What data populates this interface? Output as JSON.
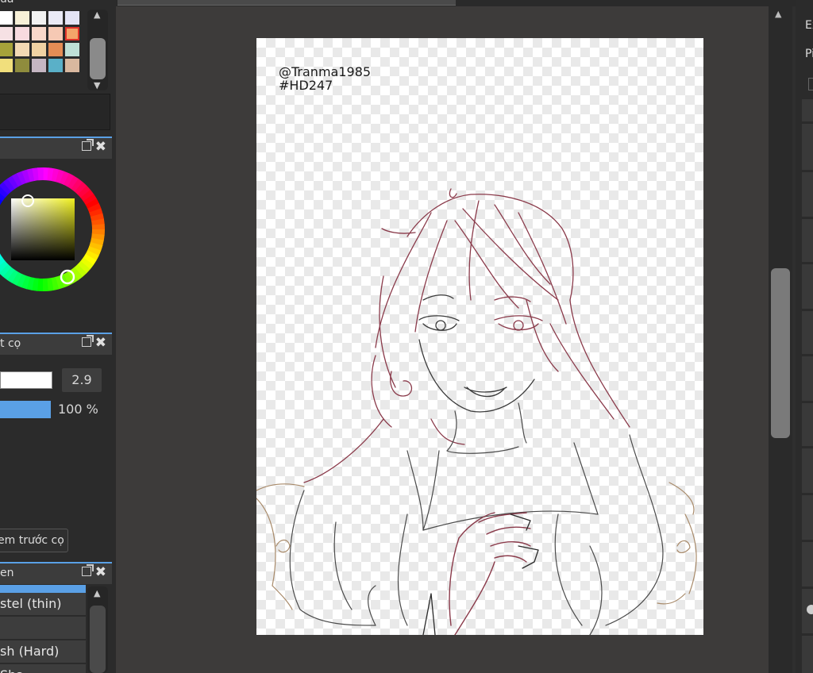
{
  "palette": {
    "title_fragment": "ủa",
    "colors": [
      [
        "#ffffff",
        "#f7f0d7",
        "#f2f2f2",
        "#eaeaf6",
        "#e4e4f5"
      ],
      [
        "#f6e1e4",
        "#f7dadf",
        "#f8d8ca",
        "#f6c9b4",
        "#f4a46a"
      ],
      [
        "#a6a23a",
        "#f3d9b4",
        "#f0d2a3",
        "#e58d55",
        "#bfe0d6"
      ],
      [
        "#f1df7c",
        "#8f8c3d",
        "#c5b6c2",
        "#5ab0c8",
        "#d9b89f"
      ]
    ],
    "selected_index": [
      1,
      4
    ]
  },
  "color_wheel_panel": {
    "hue_color": "#f0f020"
  },
  "brush_panel": {
    "title_fragment": "t cọ",
    "size_value": "2.9",
    "opacity_value": "100 %",
    "preview_button": "em trước cọ"
  },
  "brush_list_panel": {
    "title_fragment": "en",
    "items": [
      "stel (thin)",
      "",
      "sh (Hard)",
      "Sha..."
    ]
  },
  "canvas": {
    "signature_line1": "@Tranma1985",
    "signature_line2": "#HD247"
  },
  "right_panel": {
    "label1": "Ex",
    "label2": "Pi"
  },
  "accent_color": "#5aa0e6"
}
